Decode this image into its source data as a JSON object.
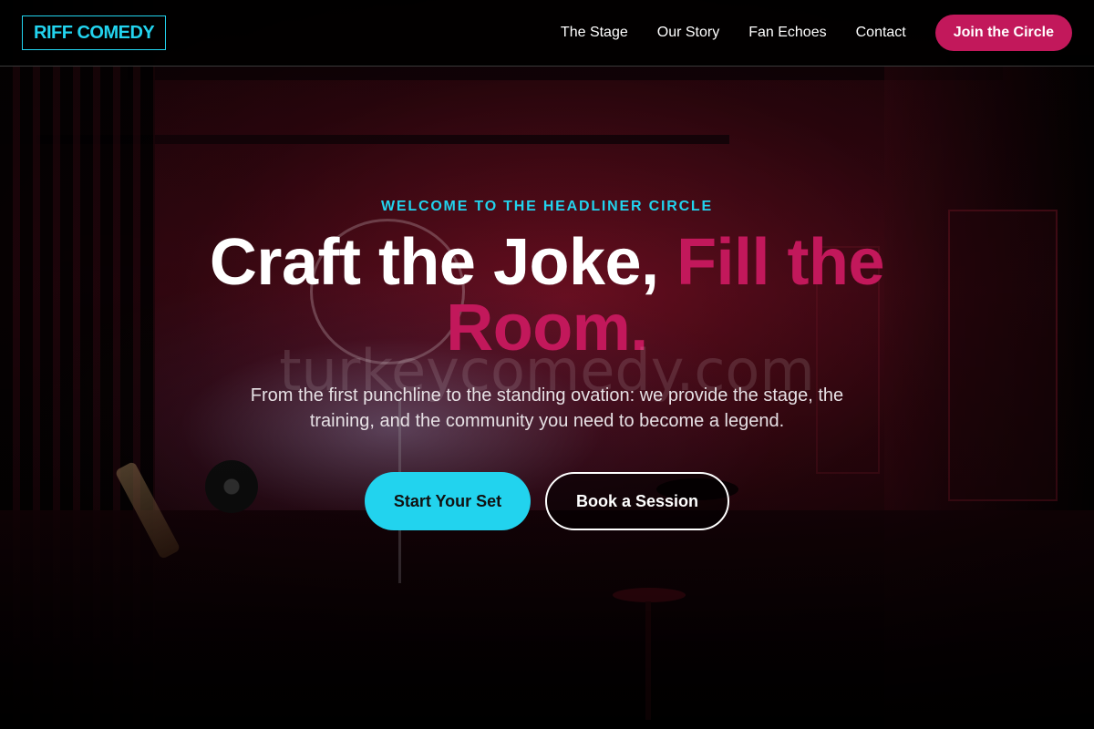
{
  "nav": {
    "logo": "RIFF COMEDY",
    "links": [
      "The Stage",
      "Our Story",
      "Fan Echoes",
      "Contact"
    ],
    "cta_label": "Join the Circle"
  },
  "hero": {
    "eyebrow": "WELCOME TO THE HEADLINER CIRCLE",
    "headline_plain": "Craft the Joke, ",
    "headline_accent": "Fill the Room.",
    "subtext": "From the first punchline to the standing ovation: we provide the stage, the training, and the community you need to become a legend.",
    "primary_button": "Start Your Set",
    "secondary_button": "Book a Session"
  },
  "watermark": "turkeycomedy.com",
  "colors": {
    "accent_cyan": "#22d3ee",
    "accent_magenta": "#c2185b",
    "navbar_bg": "#000000"
  }
}
